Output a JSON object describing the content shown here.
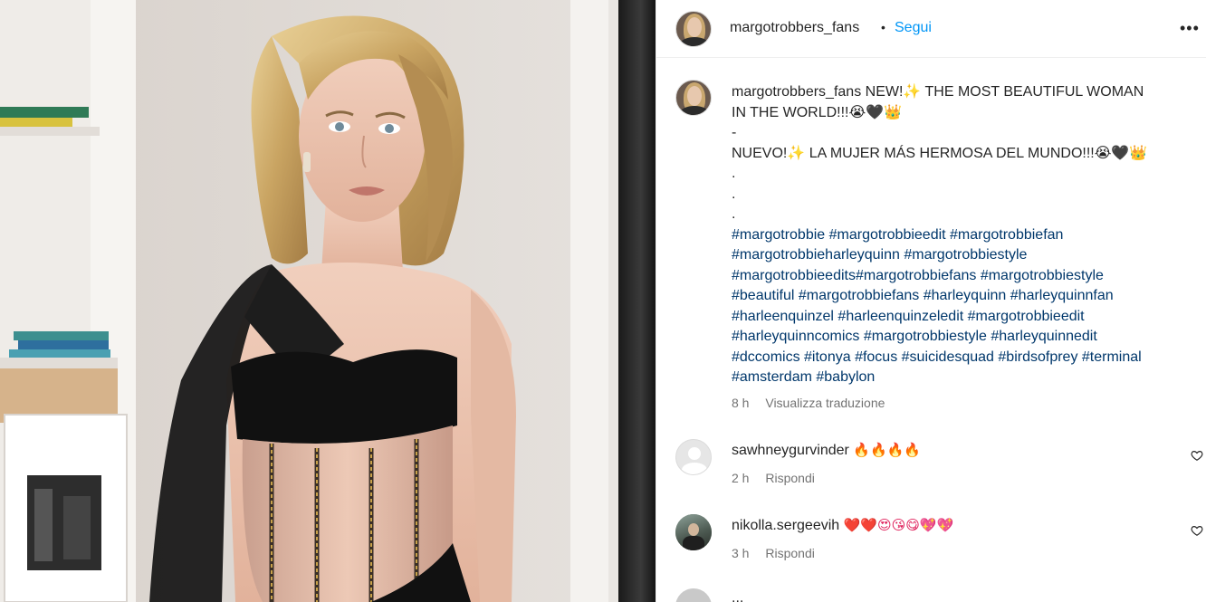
{
  "post": {
    "username": "margotrobbers_fans",
    "separator": "•",
    "follow_label": "Segui",
    "more_label": "•••"
  },
  "caption": {
    "username": "margotrobbers_fans",
    "line1_text": "NEW!✨ THE MOST BEAUTIFUL WOMAN",
    "line2_text": "IN THE WORLD!!!😭🖤👑",
    "line3_text": "-",
    "line4_text": "NUEVO!✨ LA MUJER MÁS HERMOSA DEL MUNDO!!!😭🖤👑",
    "dot_lines": [
      ".",
      ".",
      "."
    ],
    "hashtag_lines": [
      "#margotrobbie #margotrobbieedit #margotrobbiefan",
      "#margotrobbieharleyquinn #margotrobbiestyle",
      "#margotrobbieedits#margotrobbiefans #margotrobbiestyle",
      "#beautiful #margotrobbiefans #harleyquinn #harleyquinnfan",
      "#harleenquinzel #harleenquinzeledit #margotrobbieedit",
      "#harleyquinncomics #margotrobbiestyle #harleyquinnedit",
      "#dccomics #itonya #focus #suicidesquad #birdsofprey #terminal",
      "#amsterdam #babylon"
    ],
    "time": "8 h",
    "translate_label": "Visualizza traduzione"
  },
  "comments": [
    {
      "username": "sawhneygurvinder",
      "text": "🔥🔥🔥🔥",
      "time": "2 h",
      "reply_label": "Rispondi",
      "avatar": "default-avatar-icon"
    },
    {
      "username": "nikolla.sergeevih",
      "text": "❤️❤️😍😘😋💖💖",
      "time": "3 h",
      "reply_label": "Rispondi",
      "avatar": "user-photo-avatar"
    }
  ],
  "next_comment_peek": "...",
  "colors": {
    "link": "#0095f6",
    "hashtag": "#00376b",
    "muted": "#737373",
    "text": "#262626"
  }
}
